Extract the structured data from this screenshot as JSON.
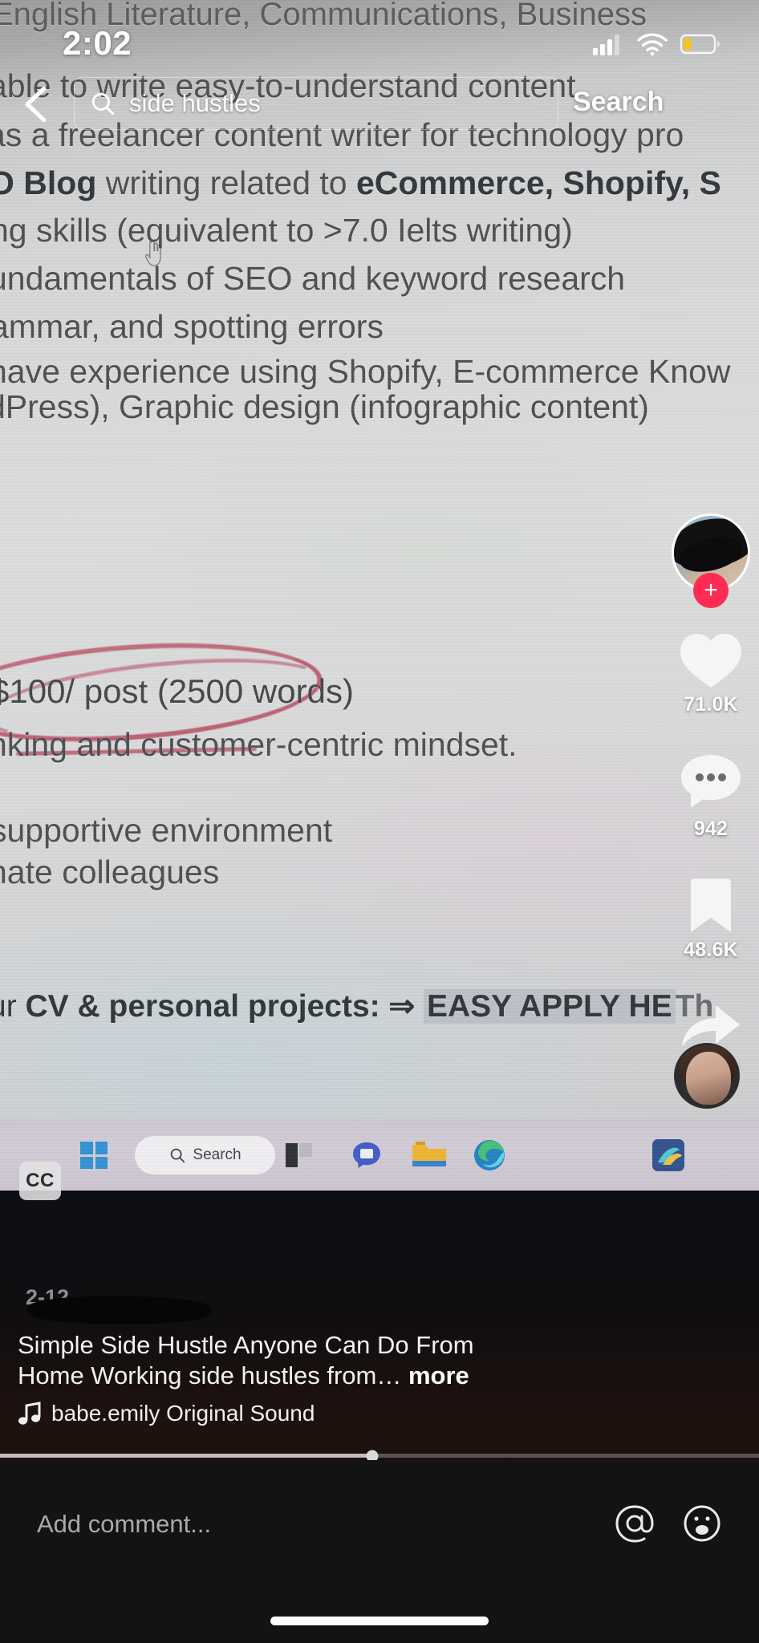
{
  "status_bar": {
    "time": "2:02",
    "cellular_icon": "cellular-bars-icon",
    "wifi_icon": "wifi-icon",
    "battery_icon": "battery-low-icon"
  },
  "search": {
    "back_icon": "back-chevron-icon",
    "search_icon": "search-icon",
    "query": "side hustles",
    "placeholder": "Search",
    "button_label": "Search"
  },
  "video_document": {
    "lines": [
      "English Literature, Communications, Business",
      "able to write easy-to-understand content",
      "as a freelancer content writer for technology pro",
      "O Blog writing related to eCommerce, Shopify, S",
      "ng skills (equivalent to >7.0 Ielts writing)",
      "undamentals of SEO and keyword research",
      "ammar, and spotting errors",
      "have experience using Shopify, E-commerce Know",
      "dPress), Graphic design (infographic content)",
      "$100/ post (2500 words)",
      "nking and customer-centric mindset.",
      "supportive environment",
      "nate colleagues"
    ],
    "bold_line_prefix": "O Blog",
    "bold_line_rest": " writing related to ",
    "bold_line_tail": "eCommerce, Shopify, S",
    "cta_line_prefix": "ur ",
    "cta_line_bold": "CV & personal projects",
    "cta_line_arrow": ": ⇒ ",
    "cta_line_highlight": "EASY APPLY HE",
    "cta_line_tail": "Th",
    "annotation": "red-circle-around-price",
    "cursor_icon": "pointer-hand-cursor-icon"
  },
  "taskbar": {
    "start_icon": "windows-start-icon",
    "search_icon": "search-icon",
    "search_label": "Search",
    "apps": [
      "task-view-icon",
      "chat-icon",
      "file-explorer-icon",
      "edge-browser-icon",
      "store-icon"
    ]
  },
  "actions": {
    "avatar": {
      "name": "creator-avatar",
      "follow_icon": "plus-follow-icon"
    },
    "like": {
      "icon": "heart-icon",
      "count": "71.0K"
    },
    "comment": {
      "icon": "comment-bubble-icon",
      "count": "942"
    },
    "bookmark": {
      "icon": "bookmark-icon",
      "count": "48.6K"
    },
    "share": {
      "icon": "share-arrow-icon",
      "label": "Share"
    },
    "music_disc": "spinning-music-disc"
  },
  "cc_badge": {
    "label": "CC"
  },
  "post": {
    "username_redacted": true,
    "date": "2-12",
    "caption_line1": "Simple Side Hustle Anyone Can Do From",
    "caption_line2": "Home  Working side hustles from… ",
    "caption_more": "more",
    "music_icon": "music-note-icon",
    "sound_name": "babe.emily Original Sound"
  },
  "progress": {
    "percent": 49
  },
  "comment_bar": {
    "placeholder": "Add comment...",
    "mention_icon": "at-mention-icon",
    "emoji_icon": "emoji-icon"
  },
  "home_indicator": "home-indicator"
}
